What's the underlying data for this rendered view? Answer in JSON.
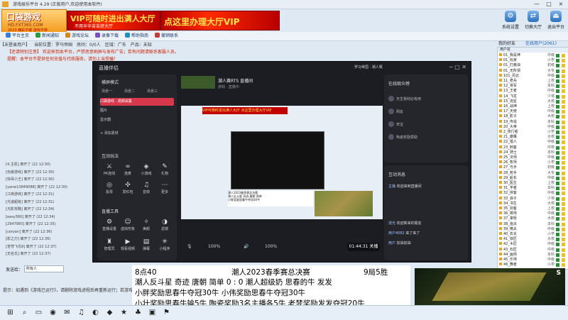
{
  "window": {
    "title": "游戏娱乐平台 4.29 (正版用户,欢迎使用本软件)",
    "controls": [
      "—",
      "□",
      "×"
    ]
  },
  "logo": {
    "line1": "口袋游戏",
    "line2": "HD.FXT365.COM",
    "line3": "2023 精彩不断 游戏不停"
  },
  "banners": [
    {
      "title": "VIP可随时进出满人大厅",
      "sub": "不用辛辛苦苦挤大厅"
    },
    {
      "title": "点这里办理大厅VIP",
      "sub": ""
    }
  ],
  "top_icons": [
    {
      "label": "系统设置",
      "icon": "gear-icon",
      "glyph": "⚙"
    },
    {
      "label": "切换大厅",
      "icon": "switch-icon",
      "glyph": "⇄"
    },
    {
      "label": "退出平台",
      "icon": "exit-icon",
      "glyph": "⏏"
    }
  ],
  "toolbar": [
    {
      "label": "平台主页",
      "color": "#3a7bd5"
    },
    {
      "label": "新闻通知",
      "color": "#2b9a3e"
    },
    {
      "label": "游戏论坛",
      "color": "#d08a1e"
    },
    {
      "label": "录像下载",
      "color": "#7a4fc0"
    },
    {
      "label": "帮助指南",
      "color": "#1f8fbf"
    },
    {
      "label": "撤销联系",
      "color": "#c23a3a"
    }
  ],
  "address": [
    "【未登录用户】",
    "当前位置：罗马帝国",
    "房间：0/0人",
    "区域：广东",
    "产品：未知"
  ],
  "notice1": "【还请特别注意】 欢迎来到本平台，严禁恶意刷屏与发布广告；若有问题请联系客服人员。",
  "notice2": "提醒：本平台不提供任何充值与代练服务，请勿上当受骗！",
  "log": [
    "[4.主机] 离开了 (22 12:30)",
    "[伪装游戏] 离开了 (22 12:30)",
    "[快哥小王] 离开了 (22 12:30)",
    "[yanw13849088] 离开了 (22 12:30)",
    "[江南游侠] 离开了 (22 12:31)",
    "[光速超级] 离开了 (22 12:31)",
    "[光影攻略] 离开了 (22 12:34)",
    "[easy360] 离开了 (22 12:34)",
    "[2947983] 离开了 (22 12:35)",
    "[ceryan] 离开了 (22 12:36)",
    "[影之刃] 离开了 (22 12:36)",
    "[苍穹飞鸟9] 离开了 (22 12:37)",
    "[无名氏] 离开了 (22 12:37)"
  ],
  "send": {
    "label": "发送给：",
    "value": "所有人"
  },
  "bottom_hint": "提示：如遇到《游戏已运行》，请删除游戏进程后再重新运行；若游戏卡死，请重启。",
  "taskbar_icons": [
    "⊞",
    "⌕",
    "▭",
    "◉",
    "✉",
    "♫",
    "◐",
    "◆",
    "★",
    "♣",
    "▣",
    "⚑"
  ],
  "right_tabs": [
    "我的好友",
    "在线用户(2061)"
  ],
  "user_header": "用户名",
  "users": [
    [
      "01_我是神",
      "中级"
    ],
    [
      "01_玩家",
      "小学"
    ],
    [
      "01_打酱油",
      "初级"
    ],
    [
      "01_无所谓",
      "大专"
    ],
    [
      "101_风云",
      "中级"
    ],
    [
      "11_老兵",
      "上校"
    ],
    [
      "12_将军",
      "本科"
    ],
    [
      "13_王者",
      "中级"
    ],
    [
      "14_飞龙",
      "少将"
    ],
    [
      "15_流星",
      "大校"
    ],
    [
      "16_战神",
      "上校"
    ],
    [
      "17_天使",
      "中级"
    ],
    [
      "18_影子",
      "大校"
    ],
    [
      "19_传说",
      "本科"
    ],
    [
      "20_大帝",
      "中级"
    ],
    [
      "2_夜行者",
      "小学"
    ],
    [
      "21_雄鹰",
      "大校"
    ],
    [
      "22_猎人",
      "中级"
    ],
    [
      "23_刺客",
      "中校"
    ],
    [
      "24_骑士",
      "本科"
    ],
    [
      "25_法师",
      "中级"
    ],
    [
      "26_牧师",
      "小学"
    ],
    [
      "27_弓手",
      "初级"
    ],
    [
      "28_枪手",
      "大专"
    ],
    [
      "29_船长",
      "中级"
    ],
    [
      "30_医生",
      "上校"
    ],
    [
      "31_学者",
      "本科"
    ],
    [
      "32_侠客",
      "中级"
    ],
    [
      "33_浪子",
      "少将"
    ],
    [
      "34_书生",
      "大校"
    ],
    [
      "35_剑客",
      "上校"
    ],
    [
      "36_镖师",
      "中级"
    ],
    [
      "37_掌柜",
      "大校"
    ],
    [
      "38_渔夫",
      "本科"
    ],
    [
      "39_樵夫",
      "中级"
    ],
    [
      "40_农夫",
      "小学"
    ],
    [
      "41_铁匠",
      "大校"
    ],
    [
      "42_木匠",
      "中级"
    ],
    [
      "43_石匠",
      "中校"
    ],
    [
      "44_画师",
      "本科"
    ],
    [
      "45_乐师",
      "中级"
    ],
    [
      "46_舞者",
      "小学"
    ]
  ],
  "obs": {
    "title": "直播伴侣",
    "account": "罗马帝国 · 潮人赛",
    "mode": "横屏模式",
    "scene_tabs": [
      "场景一",
      "场景二",
      "场景三"
    ],
    "sources": [
      "口袋游戏 · 视频采集",
      "图片",
      "显示器"
    ],
    "add_source": "+ 添加素材",
    "tools_title": "互动玩法",
    "tools": [
      "PK连线",
      "连麦",
      "小游戏",
      "礼物",
      "投票",
      "发红包",
      "音效",
      "更多"
    ],
    "live_tools_title": "直播工具",
    "live_tools": [
      "直播设置",
      "虚拟形象",
      "美颜",
      "滤镜",
      "管理员",
      "观看视频",
      "弹幕",
      "小程序"
    ],
    "stream_title": "潮人赛RTS 直播间",
    "stream_meta": "游戏 · 直播中",
    "time": "01:44:31",
    "end_label": "关播",
    "volume": [
      "100%",
      "100%"
    ],
    "audience_title": "在线观众榜",
    "audience": [
      "天生我材必有用",
      "网友",
      "宋宝",
      "陶瓷奖励赞助"
    ],
    "chat_title": "互动消息",
    "chat": [
      {
        "user": "主播",
        "text": "欢迎来到直播间"
      },
      {
        "user": "流光",
        "text": "欢迎新来的朋友"
      },
      {
        "user": "用户4082",
        "text": "来了来了"
      },
      {
        "user": "用户",
        "text": "加油加油"
      }
    ],
    "preview_vip": "VIP可随时进出满人大厅  点这里办理大厅VIP",
    "preview_overlay": "潮人2023春季赛总决赛\n潮人反斗星 奇迹 唐朝 简单\n小胖奖励思春牛夺冠30牛"
  },
  "overlay": {
    "line1_time": "8点40",
    "line1_title": "潮人2023春季赛总决赛",
    "line1_right": "9局5胜",
    "line2": "潮人反斗星  奇迹  唐朝  简单     0  :  0    潮人超级奶 思春的牛 发发",
    "line3": "小胖奖励思春牛夺冠30牛    小伟奖励思春牛夺冠30牛",
    "line4": "小壮奖励思春牛输5牛   陶瓷奖励3名主播各5牛   老梦奖励发发夺冠20牛"
  },
  "minimap_label": "S"
}
